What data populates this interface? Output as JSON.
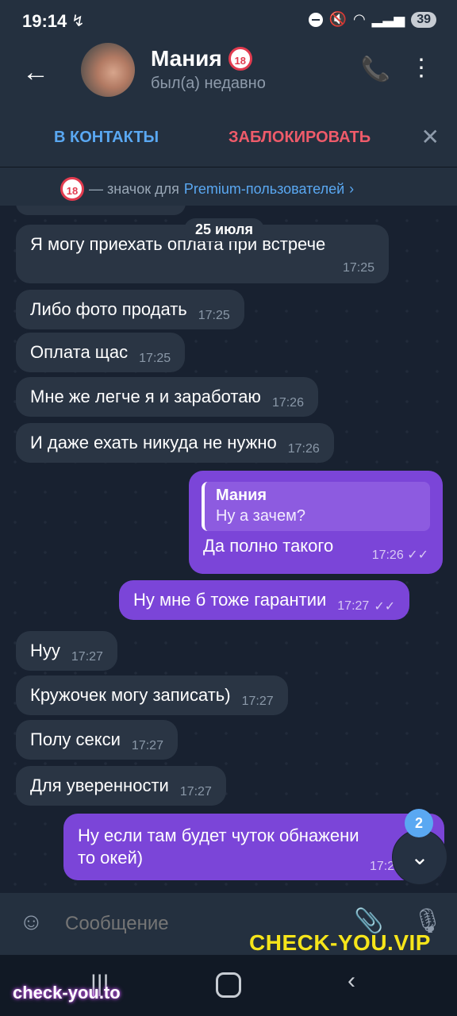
{
  "status_bar": {
    "time": "19:14",
    "battery": "39"
  },
  "chat_header": {
    "name": "Мания",
    "badge": "18",
    "status": "был(а) недавно"
  },
  "action_bar": {
    "add_contact": "В КОНТАКТЫ",
    "block": "ЗАБЛОКИРОВАТЬ"
  },
  "premium_banner": {
    "prefix": "— значок для",
    "link": "Premium-пользователей"
  },
  "date_divider": "25 июля",
  "messages": [
    {
      "text": "Я могу приехать оплата при встрече",
      "time": "17:25",
      "direction": "in"
    },
    {
      "text": "Либо фото продать",
      "time": "17:25",
      "direction": "in"
    },
    {
      "text": "Оплата щас",
      "time": "17:25",
      "direction": "in"
    },
    {
      "text": "Мне же легче я и заработаю",
      "time": "17:26",
      "direction": "in"
    },
    {
      "text": "И даже ехать никуда не нужно",
      "time": "17:26",
      "direction": "in"
    },
    {
      "quote_name": "Мания",
      "quote_text": "Ну а зачем?",
      "text": "Да полно такого",
      "time": "17:26",
      "direction": "out"
    },
    {
      "text": "Ну мне б тоже гарантии",
      "time": "17:27",
      "direction": "out"
    },
    {
      "text": "Нуу",
      "time": "17:27",
      "direction": "in"
    },
    {
      "text": "Кружочек могу записать)",
      "time": "17:27",
      "direction": "in"
    },
    {
      "text": "Полу секси",
      "time": "17:27",
      "direction": "in"
    },
    {
      "text": "Для уверенности",
      "time": "17:27",
      "direction": "in"
    },
    {
      "line1": "Ну если там будет чуток обнажени",
      "line2": "то окей)",
      "time": "17:2",
      "direction": "out"
    }
  ],
  "scroll_down": {
    "unread_count": "2"
  },
  "composer": {
    "placeholder": "Сообщение"
  },
  "watermarks": {
    "top": "CHECK-YOU.VIP",
    "bottom": "check-you.to"
  },
  "colors": {
    "outgoing_bubble": "#7b45d8",
    "incoming_bubble": "#2a3544",
    "accent_blue": "#5aa8f2",
    "block_red": "#ef5b6a"
  }
}
